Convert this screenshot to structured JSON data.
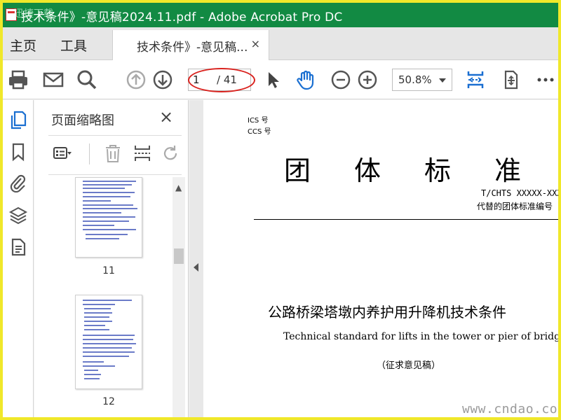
{
  "window": {
    "title": "技术条件》-意见稿2024.11.pdf - Adobe Acrobat Pro DC",
    "watermark": "迅捷下载"
  },
  "menu_tabs": [
    "主页",
    "工具"
  ],
  "doc_tab": {
    "label": "技术条件》-意见稿...",
    "close": "×"
  },
  "toolbar": {
    "page_current": "1",
    "page_total": "/ 41",
    "zoom": "50.8%",
    "icons": [
      "print-icon",
      "email-icon",
      "search-icon",
      "page-up-icon",
      "page-down-icon",
      "select-cursor-icon",
      "hand-tool-icon",
      "zoom-out-icon",
      "zoom-in-icon",
      "fit-page-icon",
      "rotate-page-icon",
      "more-icon"
    ]
  },
  "rail": {
    "icons": [
      "page-thumbnails-icon",
      "bookmark-icon",
      "attachment-icon",
      "layers-icon",
      "document-properties-icon"
    ]
  },
  "thumbnails": {
    "title": "页面缩略图",
    "close": "×",
    "pages": [
      {
        "number": "11"
      },
      {
        "number": "12"
      }
    ]
  },
  "document": {
    "ics": "ICS 号",
    "ccs": "CCS 号",
    "big_title": [
      "团",
      "体",
      "标",
      "准"
    ],
    "std_no": "T/CHTS XXXXX-XXXX",
    "replaced": "代替的团体标准编号",
    "cn_title": "公路桥梁塔墩内养护用升降机技术条件",
    "en_title": "Technical standard for lifts in the tower or pier of bridge",
    "draft": "（征求意见稿）"
  },
  "site_mark": "www.cndao.com",
  "colors": {
    "titlebar": "#128a43",
    "accent_icon": "#1a6fd1",
    "highlight_oval": "#d9221e",
    "frame": "#f0e82a"
  }
}
